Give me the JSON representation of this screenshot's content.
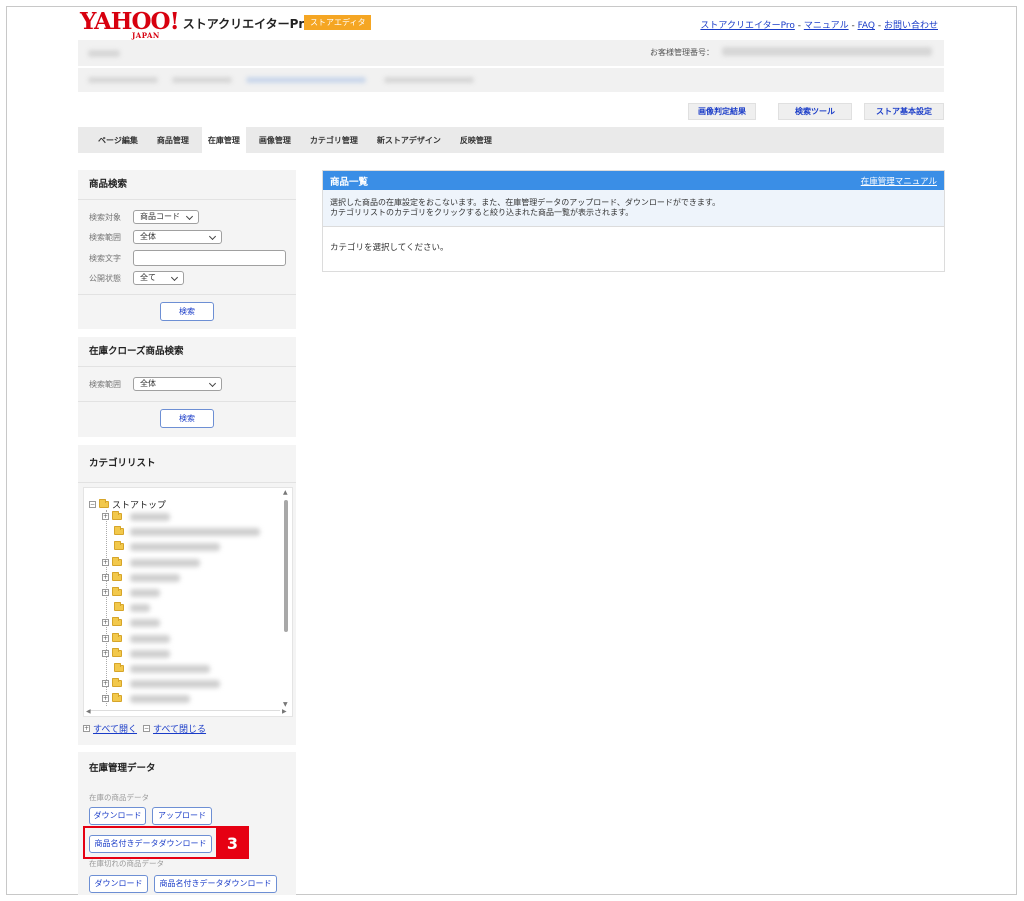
{
  "header": {
    "logo_text": "YAHOO!",
    "logo_sub": "JAPAN",
    "product_name": "ストアクリエイターPro",
    "editor_badge": "ストアエディタ",
    "links": [
      "ストアクリエイターPro",
      "マニュアル",
      "FAQ",
      "お問い合わせ"
    ],
    "link_separator": " - ",
    "customer_number_label": "お客様管理番号："
  },
  "toolbar": {
    "image_check": "画像判定結果",
    "search_tool": "検索ツール",
    "store_settings": "ストア基本設定"
  },
  "nav": {
    "items": [
      "ページ編集",
      "商品管理",
      "在庫管理",
      "画像管理",
      "カテゴリ管理",
      "新ストアデザイン",
      "反映管理"
    ],
    "active": "在庫管理"
  },
  "product_search": {
    "title": "商品検索",
    "target_label": "検索対象",
    "target_value": "商品コード",
    "range_label": "検索範囲",
    "range_value": "全体",
    "keyword_label": "検索文字",
    "keyword_value": "",
    "status_label": "公開状態",
    "status_value": "全て",
    "search_button": "検索"
  },
  "closed_search": {
    "title": "在庫クローズ商品検索",
    "range_label": "検索範囲",
    "range_value": "全体",
    "search_button": "検索"
  },
  "category_list": {
    "title": "カテゴリリスト",
    "root": "ストアトップ",
    "expand_all": "すべて開く",
    "collapse_all": "すべて閉じる"
  },
  "stock_data": {
    "title": "在庫管理データ",
    "in_stock_label": "在庫の商品データ",
    "download": "ダウンロード",
    "upload": "アップロード",
    "named_download": "商品名付きデータダウンロード",
    "out_of_stock_label": "在庫切れの商品データ",
    "download2": "ダウンロード",
    "named_download2": "商品名付きデータダウンロード",
    "step_number": "3"
  },
  "main": {
    "title": "商品一覧",
    "manual_link": "在庫管理マニュアル",
    "desc_line1": "選択した商品の在庫設定をおこないます。また、在庫管理データのアップロード、ダウンロードができます。",
    "desc_line2": "カテゴリリストのカテゴリをクリックすると絞り込まれた商品一覧が表示されます。",
    "body": "カテゴリを選択してください。"
  },
  "colors": {
    "accent_blue": "#3a8ee6",
    "link_blue": "#1a3cc8",
    "brand_red": "#d7000f",
    "badge_orange": "#f5a623",
    "highlight_red": "#e60012"
  }
}
